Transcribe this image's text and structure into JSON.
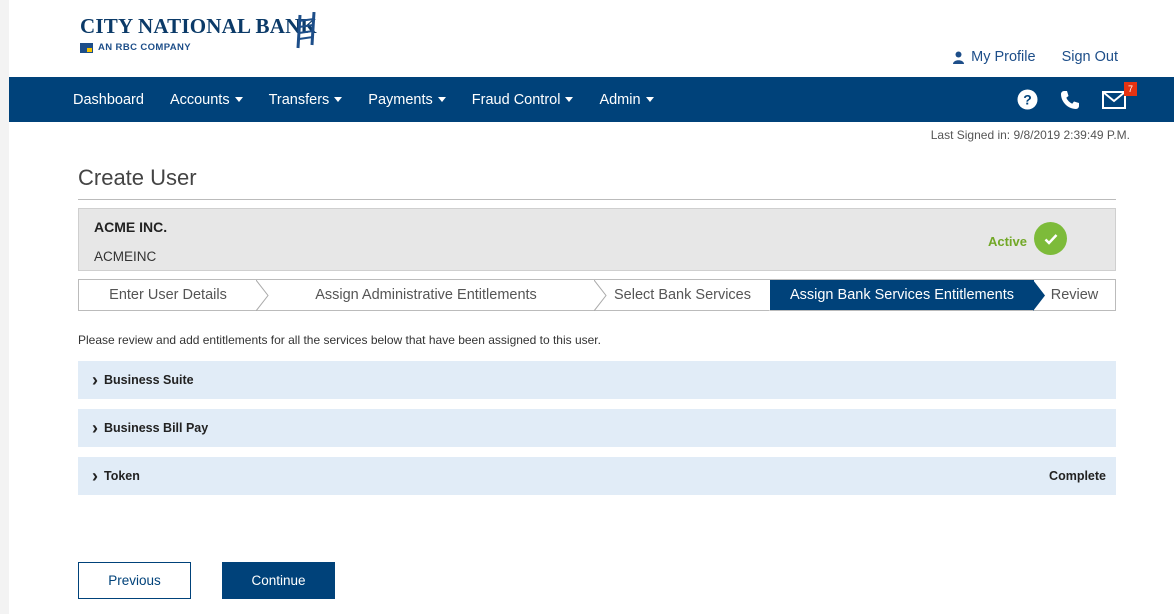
{
  "brand": {
    "name": "CITY NATIONAL BANK",
    "sub": "AN RBC COMPANY"
  },
  "top_links": {
    "profile": "My Profile",
    "signout": "Sign Out"
  },
  "nav": [
    {
      "label": "Dashboard",
      "dropdown": false
    },
    {
      "label": "Accounts",
      "dropdown": true
    },
    {
      "label": "Transfers",
      "dropdown": true
    },
    {
      "label": "Payments",
      "dropdown": true
    },
    {
      "label": "Fraud Control",
      "dropdown": true
    },
    {
      "label": "Admin",
      "dropdown": true
    }
  ],
  "nav_icons": {
    "help": "help-icon",
    "phone": "phone-icon",
    "mail": "mail-icon",
    "mail_count": "7"
  },
  "last_signed": "Last Signed in: 9/8/2019 2:39:49 P.M.",
  "page_title": "Create User",
  "company": {
    "name": "ACME INC.",
    "id": "ACMEINC",
    "status": "Active"
  },
  "steps": [
    {
      "label": "Enter User Details",
      "active": false
    },
    {
      "label": "Assign Administrative Entitlements",
      "active": false
    },
    {
      "label": "Select Bank Services",
      "active": false
    },
    {
      "label": "Assign Bank Services Entitlements",
      "active": true
    },
    {
      "label": "Review",
      "active": false
    }
  ],
  "intro": "Please review and add entitlements for all the services below that have been assigned to this user.",
  "services": [
    {
      "label": "Business Suite",
      "status": ""
    },
    {
      "label": "Business Bill Pay",
      "status": ""
    },
    {
      "label": "Token",
      "status": "Complete"
    }
  ],
  "buttons": {
    "previous": "Previous",
    "continue": "Continue"
  },
  "colors": {
    "brand": "#00427a",
    "accent": "#7dbb3a",
    "row": "#e1ecf7"
  }
}
